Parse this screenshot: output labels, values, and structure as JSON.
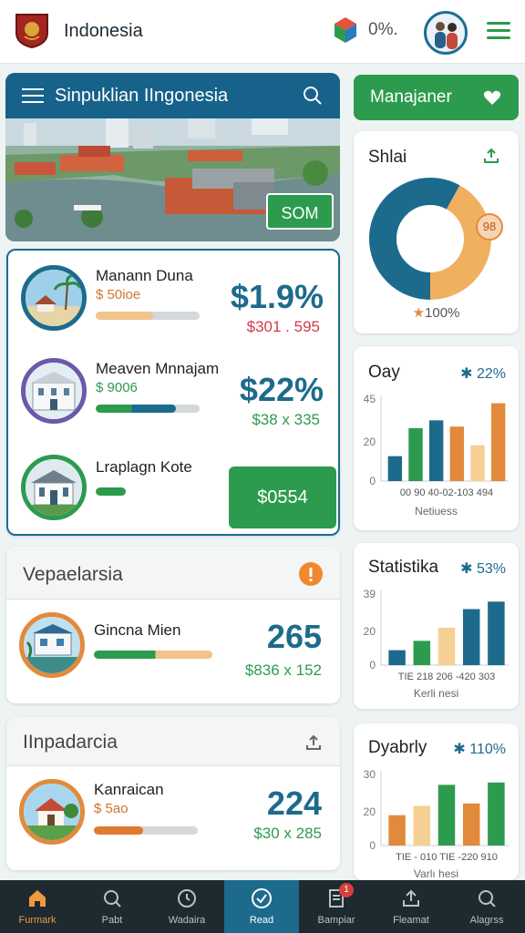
{
  "header": {
    "title": "Indonesia",
    "percent": "0%.",
    "colors": {
      "accent": "#2d9b4e",
      "primary": "#1d6b8c"
    }
  },
  "hero": {
    "title": "Sinpuklian IIngonesia",
    "badge": "SOM"
  },
  "list": {
    "items": [
      {
        "name": "Manann Duna",
        "sub": "$ 50ioe",
        "big": "$1.9%",
        "small": "$301 . 595",
        "progress": 0.55,
        "bar_color": "#f2c38a"
      },
      {
        "name": "Meaven Mnnajam",
        "sub": "$ 9006",
        "big": "$22%",
        "small": "$38 x 335",
        "progress": 0.77,
        "bar_color": "#2d9b4e"
      },
      {
        "name": "Lraplagn Kote",
        "sub": "",
        "big": "",
        "small": "",
        "progress": 0.54,
        "bar_color": "#2d9b4e"
      }
    ],
    "button": "$0554"
  },
  "section1": {
    "title": "Vepaelarsia",
    "item": {
      "name": "Gincna Mien",
      "big": "265",
      "small": "$836 x 152",
      "progress": 0.52
    }
  },
  "section2": {
    "title": "IInpadarcia",
    "item": {
      "name": "Kanraican",
      "sub": "$ 5ao",
      "big": "224",
      "small": "$30 x 285",
      "progress": 0.47
    }
  },
  "right": {
    "manage_label": "Manajaner",
    "donut": {
      "title": "Shlai",
      "label": "100%",
      "badge": "98"
    },
    "cards": [
      {
        "title": "Oay",
        "delta": "22%",
        "caption": "Netiuess",
        "y_ticks": [
          "45",
          "20",
          "0"
        ],
        "x_labels": "00  90  40-02-103  494"
      },
      {
        "title": "Statistika",
        "delta": "53%",
        "caption": "Kerli nesi",
        "y_ticks": [
          "39",
          "20",
          "0"
        ],
        "x_labels": "TIE   218   206  -420   303"
      },
      {
        "title": "Dyabrly",
        "delta": "110%",
        "caption": "Varlı hesi",
        "y_ticks": [
          "30",
          "20",
          "0"
        ],
        "x_labels": "TIE - 010   TIE  -220   910"
      }
    ]
  },
  "chart_data": [
    {
      "type": "pie",
      "title": "Shlai",
      "values": [
        58,
        42
      ],
      "colors": [
        "#1d6b8c",
        "#f0b060"
      ]
    },
    {
      "type": "bar",
      "title": "Oay",
      "values": [
        16,
        34,
        39,
        35,
        23,
        50
      ],
      "ylim": [
        0,
        55
      ],
      "colors": [
        "#1d6b8c",
        "#2d9b4e",
        "#1d6b8c",
        "#e28a3c",
        "#f6cf95",
        "#e28a3c"
      ]
    },
    {
      "type": "bar",
      "title": "Statistika",
      "values": [
        8,
        13,
        20,
        30,
        34
      ],
      "ylim": [
        0,
        40
      ],
      "colors": [
        "#1d6b8c",
        "#2d9b4e",
        "#f6cf95",
        "#1d6b8c",
        "#1d6b8c"
      ]
    },
    {
      "type": "bar",
      "title": "Dyabrly",
      "values": [
        13,
        17,
        26,
        18,
        27
      ],
      "ylim": [
        0,
        32
      ],
      "colors": [
        "#e28a3c",
        "#f6cf95",
        "#2d9b4e",
        "#e28a3c",
        "#2d9b4e"
      ]
    }
  ],
  "nav": [
    {
      "label": "Furmark",
      "icon": "home-icon"
    },
    {
      "label": "Pabt",
      "icon": "search-icon"
    },
    {
      "label": "Wadaira",
      "icon": "clock-icon"
    },
    {
      "label": "Read",
      "icon": "check-circle-icon"
    },
    {
      "label": "Bampiar",
      "icon": "document-icon",
      "badge": "1"
    },
    {
      "label": "Fleamat",
      "icon": "upload-icon"
    },
    {
      "label": "Alagrss",
      "icon": "search-icon"
    }
  ]
}
